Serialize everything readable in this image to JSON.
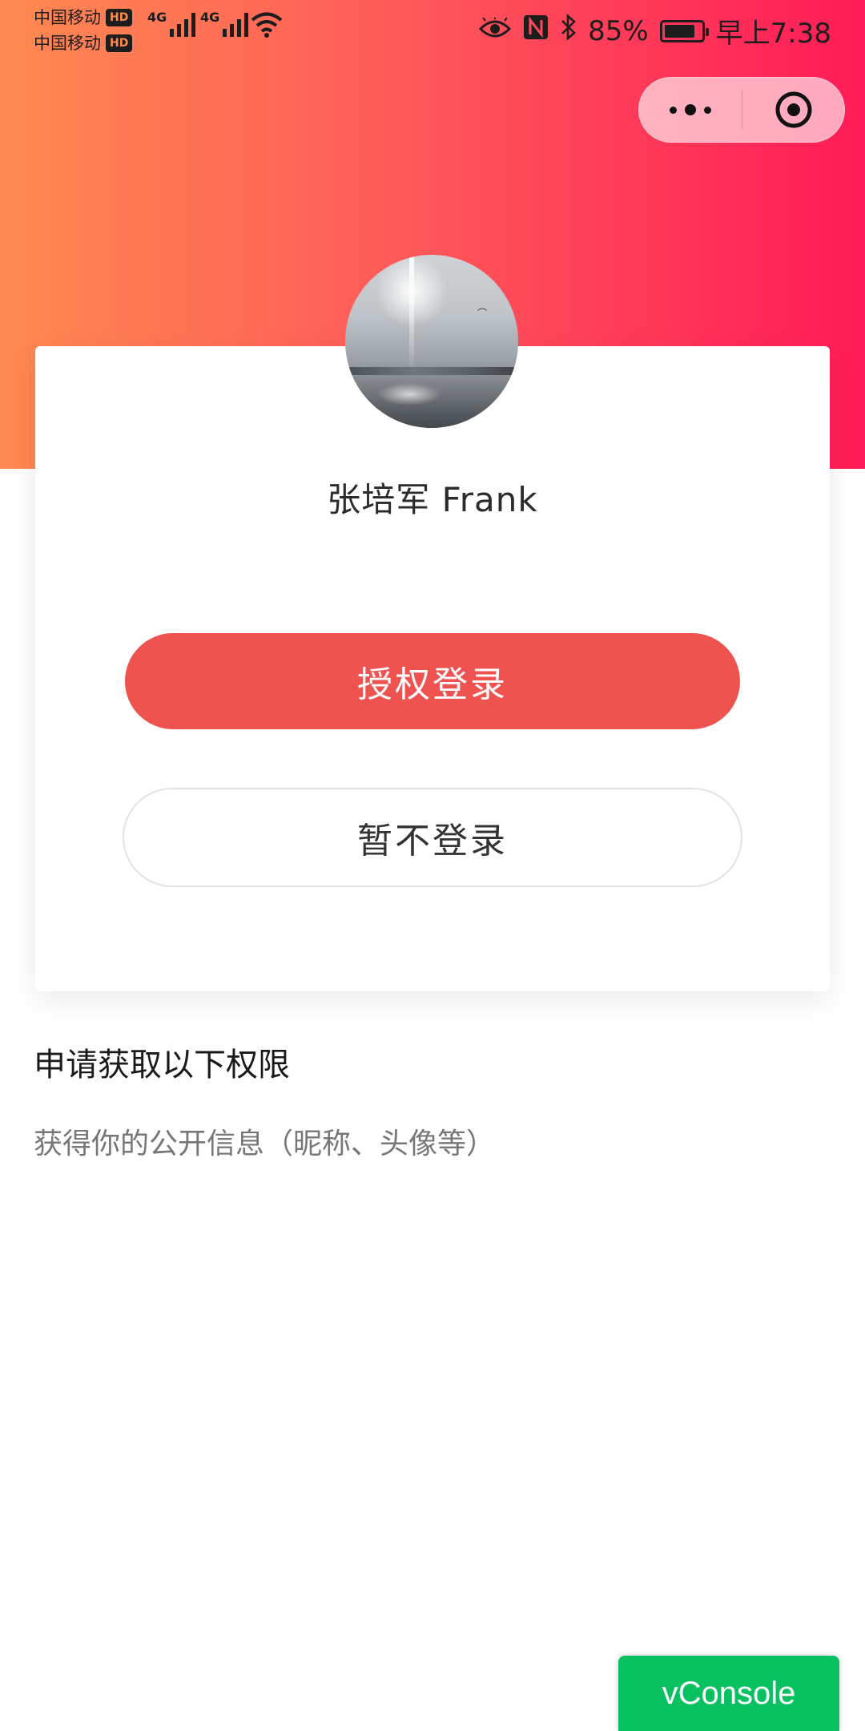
{
  "status_bar": {
    "carrier_1": "中国移动",
    "carrier_2": "中国移动",
    "hd_badge": "HD",
    "network_1": "4G",
    "network_2": "4G",
    "battery_percent": "85%",
    "time": "早上7:38",
    "icons": [
      "eye-comfort-icon",
      "nfc-icon",
      "bluetooth-icon",
      "wifi-icon",
      "battery-icon"
    ]
  },
  "capsule": {
    "more_icon": "more-dots-icon",
    "close_icon": "target-close-icon"
  },
  "profile": {
    "nickname": "张培军 Frank"
  },
  "actions": {
    "authorize_label": "授权登录",
    "skip_label": "暂不登录"
  },
  "permissions": {
    "title": "申请获取以下权限",
    "items": [
      "获得你的公开信息（昵称、头像等）"
    ]
  },
  "debug": {
    "vconsole_label": "vConsole"
  },
  "colors": {
    "gradient_start": "#ff8a50",
    "gradient_end": "#ff1b57",
    "primary_button": "#ef5350",
    "vconsole_green": "#07c160"
  }
}
